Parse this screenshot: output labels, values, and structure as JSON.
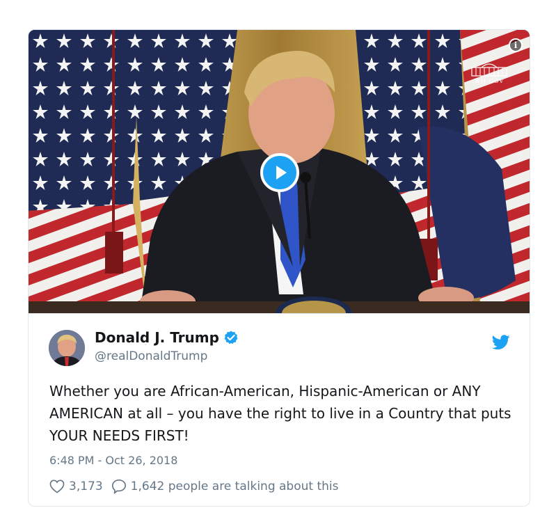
{
  "media": {
    "watermark_text": "WH.GOV",
    "info_icon": "info-icon",
    "play_icon": "play-icon"
  },
  "author": {
    "name": "Donald J. Trump",
    "handle": "@realDonaldTrump",
    "verified": true,
    "verified_color": "#1da1f2"
  },
  "tweet": {
    "text": "Whether you are African-American, Hispanic-American or ANY AMERICAN at all – you have the right to live in a Country that puts YOUR NEEDS FIRST!",
    "timestamp": "6:48 PM - Oct 26, 2018"
  },
  "stats": {
    "likes": "3,173",
    "talking": "1,642 people are talking about this"
  },
  "colors": {
    "brand": "#1da1f2",
    "text": "#14171a",
    "muted": "#657786",
    "border": "#e1e8ed"
  }
}
